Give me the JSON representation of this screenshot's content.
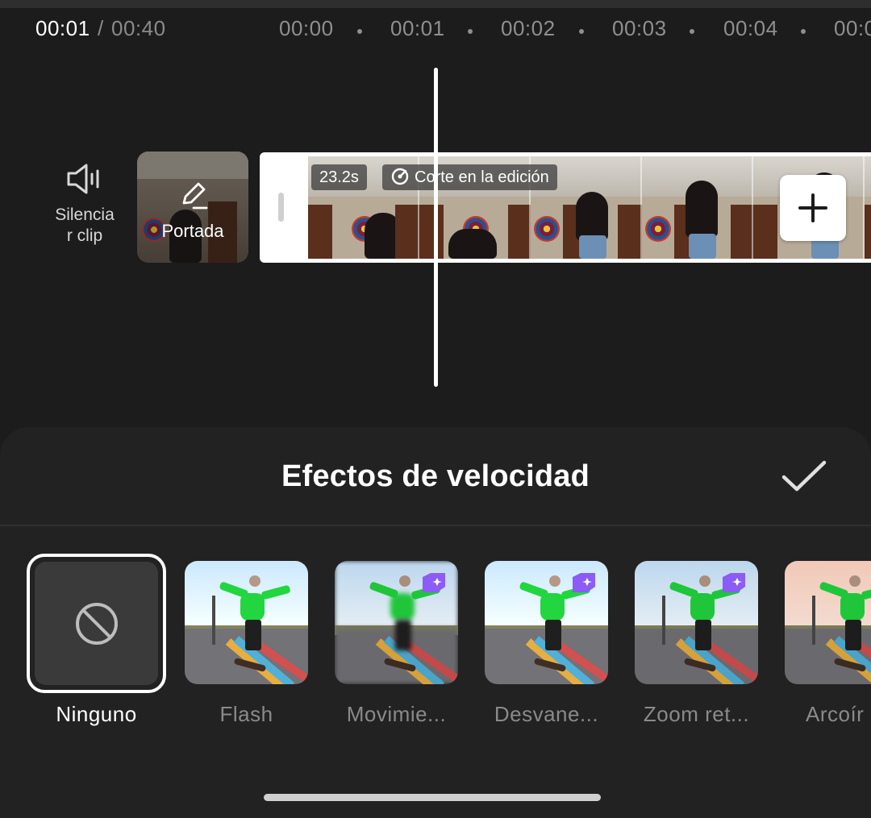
{
  "header": {
    "current_time": "00:01",
    "separator": "/",
    "total_time": "00:40"
  },
  "ruler": {
    "ticks": [
      "00:00",
      "00:01",
      "00:02",
      "00:03",
      "00:04",
      "00:0"
    ]
  },
  "tools": {
    "mute_label": "Silencia\nr clip",
    "cover_label": "Portada"
  },
  "track": {
    "duration_chip": "23.2s",
    "cut_chip": "Corte en la edición"
  },
  "sheet": {
    "title": "Efectos de velocidad",
    "effects": [
      {
        "label": "Ninguno",
        "selected": true,
        "pro": false
      },
      {
        "label": "Flash",
        "selected": false,
        "pro": false
      },
      {
        "label": "Movimie...",
        "selected": false,
        "pro": true
      },
      {
        "label": "Desvane...",
        "selected": false,
        "pro": true
      },
      {
        "label": "Zoom ret...",
        "selected": false,
        "pro": true
      },
      {
        "label": "Arcoír",
        "selected": false,
        "pro": false
      }
    ]
  },
  "icons": {
    "mute": "speaker-icon",
    "cover": "pencil-icon",
    "cut": "scissors-cut-icon",
    "add": "plus-icon",
    "confirm": "checkmark-icon",
    "none": "no-sign-icon",
    "pro": "diamond-badge-icon"
  },
  "colors": {
    "background": "#1c1c1c",
    "sheet": "#222222",
    "text_primary": "#ffffff",
    "text_secondary": "#8a8a8a",
    "pro_badge": "#8b5cf6"
  }
}
